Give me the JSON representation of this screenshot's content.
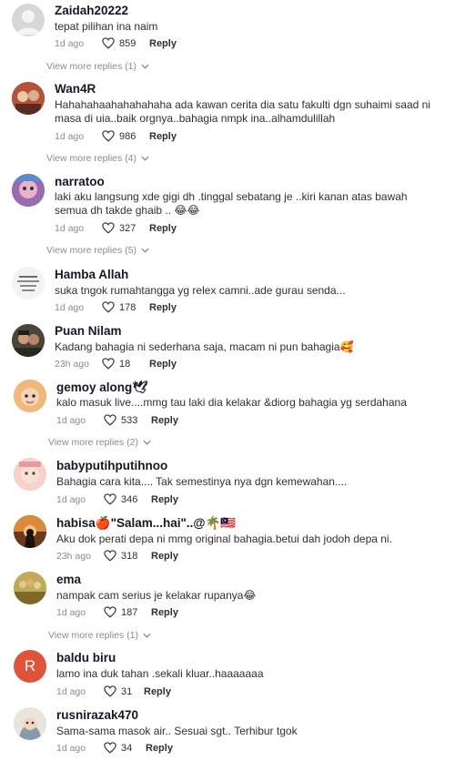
{
  "comments": [
    {
      "author": "Zaidah20222",
      "text": "tepat pilihan ina naim",
      "ago": "1d ago",
      "likes": "859",
      "reply": "Reply",
      "avatar": "default-avatar"
    },
    {
      "author": "Wan4R",
      "text": "Hahahahaahahahahaha ada kawan cerita dia satu fakulti dgn suhaimi saad ni masa di uia..baik orgnya..bahagia nmpk ina..alhamdulillah",
      "ago": "1d ago",
      "likes": "986",
      "reply": "Reply",
      "avatar": "photo-avatar"
    },
    {
      "author": "narratoo",
      "text": "laki aku langsung xde gigi dh .tinggal sebatang je ..kiri kanan atas bawah semua dh takde ghaib .. 😂😂",
      "ago": "1d ago",
      "likes": "327",
      "reply": "Reply",
      "avatar": "photo-avatar"
    },
    {
      "author": "Hamba Allah",
      "text": "suka tngok rumahtangga yg relex camni..ade gurau senda...",
      "ago": "1d ago",
      "likes": "178",
      "reply": "Reply",
      "avatar": "photo-avatar"
    },
    {
      "author": "Puan Nilam",
      "text": "Kadang bahagia ni sederhana saja, macam ni pun bahagia🥰",
      "ago": "23h ago",
      "likes": "18",
      "reply": "Reply",
      "avatar": "photo-avatar"
    },
    {
      "author": "gemoy along🕊",
      "text": "kalo masuk live....mmg tau laki dia kelakar &diorg bahagia yg serdahana",
      "ago": "1d ago",
      "likes": "533",
      "reply": "Reply",
      "avatar": "photo-avatar"
    },
    {
      "author": "babyputihputihnoo",
      "text": "Bahagia cara kita.... Tak semestinya nya dgn kemewahan....",
      "ago": "1d ago",
      "likes": "346",
      "reply": "Reply",
      "avatar": "photo-avatar"
    },
    {
      "author": "habisa🍎\"Salam...hai\"..@🌴🇲🇾",
      "text": "Aku dok perati depa ni mmg original bahagia.betui dah jodoh depa ni.",
      "ago": "23h ago",
      "likes": "318",
      "reply": "Reply",
      "avatar": "photo-avatar"
    },
    {
      "author": "ema",
      "text": "nampak cam serius je kelakar rupanya😂",
      "ago": "1d ago",
      "likes": "187",
      "reply": "Reply",
      "avatar": "photo-avatar"
    },
    {
      "author": "baldu biru",
      "text": "lamo ina duk tahan .sekali kluar..haaaaaaa",
      "ago": "1d ago",
      "likes": "31",
      "reply": "Reply",
      "avatar": "R"
    },
    {
      "author": "rusnirazak470",
      "text": "Sama-sama masok air.. Sesuai sgt.. Terhibur tgok",
      "ago": "1d ago",
      "likes": "34",
      "reply": "Reply",
      "avatar": "photo-avatar"
    }
  ],
  "view_more": [
    "View more replies (1)",
    "View more replies (4)",
    "View more replies (5)",
    "View more replies (2)",
    "View more replies (1)"
  ],
  "colors": {
    "accent_avatar_r": "#e0533b",
    "muted": "#8a8b91"
  }
}
